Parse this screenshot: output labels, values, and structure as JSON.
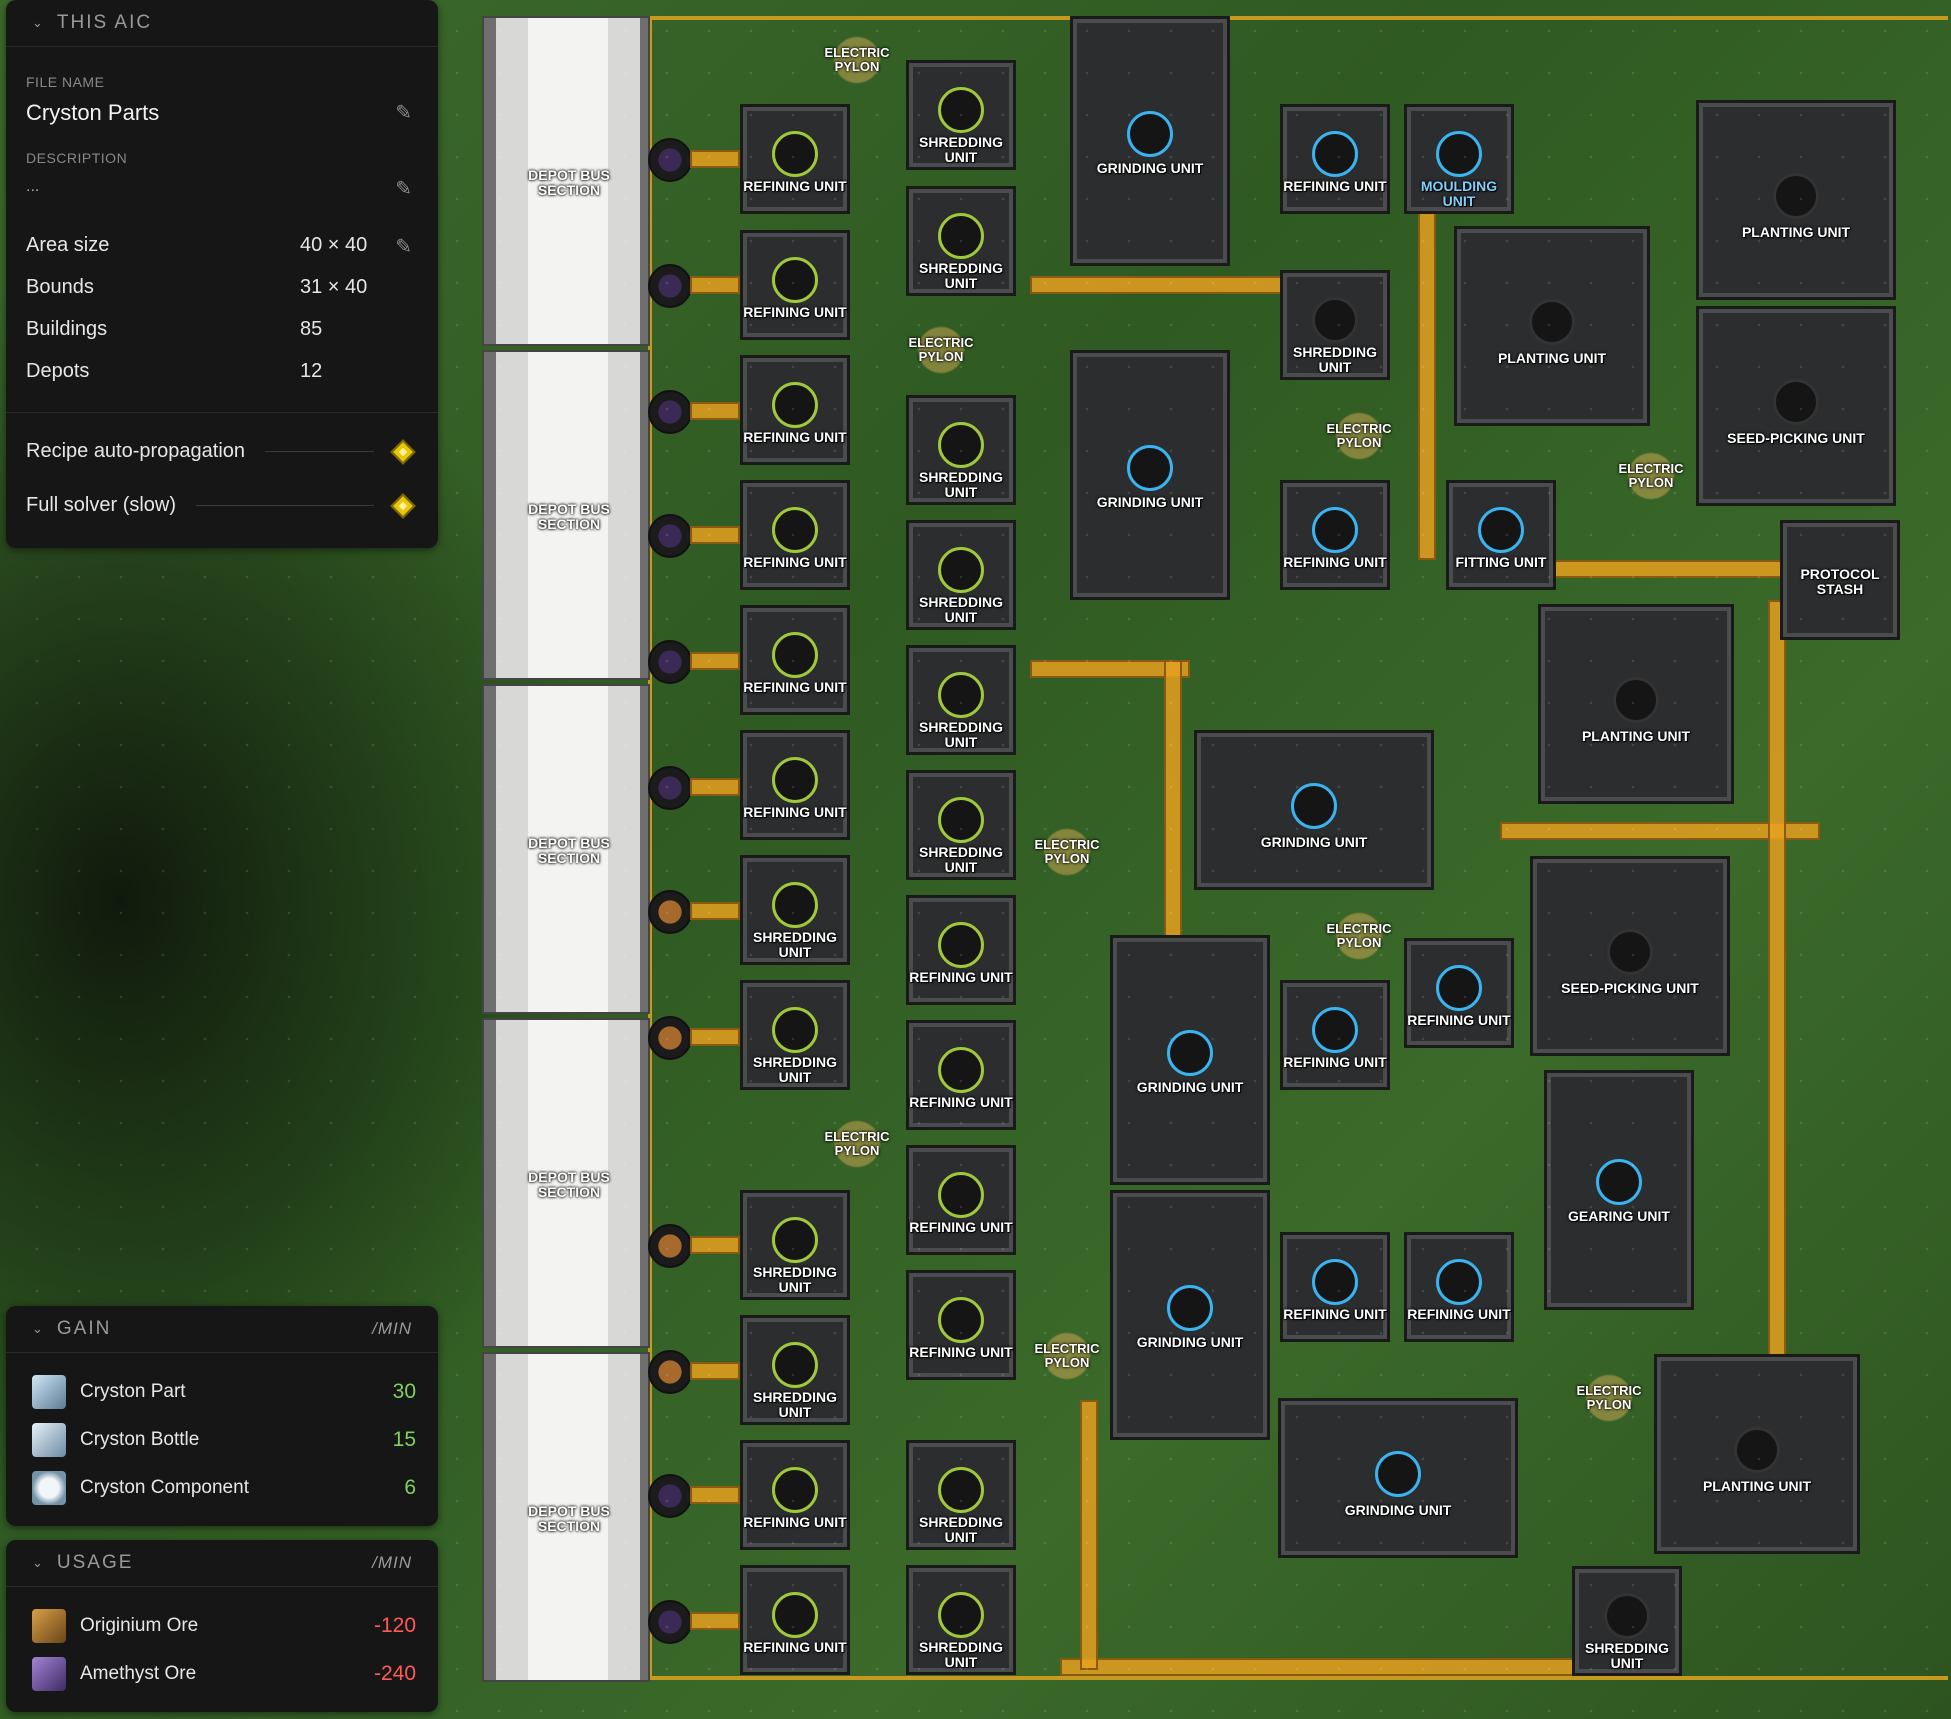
{
  "aic_panel": {
    "header": "THIS AIC",
    "file_name_label": "FILE NAME",
    "file_name": "Cryston Parts",
    "description_label": "DESCRIPTION",
    "description": "...",
    "stats": [
      {
        "label": "Area size",
        "value": "40 × 40"
      },
      {
        "label": "Bounds",
        "value": "31 × 40"
      },
      {
        "label": "Buildings",
        "value": "85"
      },
      {
        "label": "Depots",
        "value": "12"
      }
    ],
    "toggles": [
      {
        "label": "Recipe auto-propagation"
      },
      {
        "label": "Full solver (slow)"
      }
    ]
  },
  "gain_panel": {
    "header": "GAIN",
    "unit": "/MIN",
    "items": [
      {
        "name": "Cryston Part",
        "value": "30",
        "color": "#7fd35a"
      },
      {
        "name": "Cryston Bottle",
        "value": "15",
        "color": "#7fd35a"
      },
      {
        "name": "Cryston Component",
        "value": "6",
        "color": "#7fd35a"
      }
    ]
  },
  "usage_panel": {
    "header": "USAGE",
    "unit": "/MIN",
    "items": [
      {
        "name": "Originium Ore",
        "value": "-120",
        "color": "#ff5a5a"
      },
      {
        "name": "Amethyst Ore",
        "value": "-240",
        "color": "#ff5a5a"
      }
    ]
  },
  "map": {
    "depot_label": "DEPOT BUS SECTION",
    "pylon_label": "ELECTRIC PYLON",
    "labels": {
      "refining": "REFINING UNIT",
      "shredding": "SHREDDING UNIT",
      "grinding": "GRINDING UNIT",
      "moulding": "MOULDING UNIT",
      "planting": "PLANTING UNIT",
      "seed_picking": "SEED-PICKING UNIT",
      "fitting": "FITTING UNIT",
      "protocol_stash": "PROTOCOL STASH",
      "gearing": "GEARING UNIT"
    }
  }
}
